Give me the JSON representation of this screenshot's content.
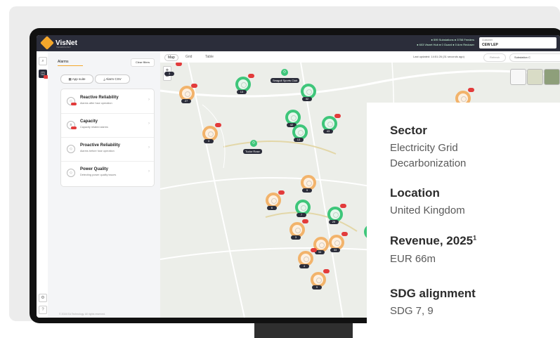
{
  "app": {
    "logo_text": "VisNet",
    "logo_sub": "TECHNOLOGY",
    "stats_line1": "● 599 Substations  ● 3758 Feeders",
    "stats_line2": "● 603 Visnet Hub  ● 0 Guard  ● 0 Arm Recloser",
    "customer_label": "Customer",
    "customer_value": "CEW LEP"
  },
  "left_panel": {
    "tab": "Alarms",
    "clear_filters": "Clear filters",
    "app_suite": "App suite",
    "alarm_csv": "Alarm CSV",
    "items": [
      {
        "title": "Reactive Reliability",
        "sub": "Alarms after fuse operation"
      },
      {
        "title": "Capacity",
        "sub": "Capacity related alarms"
      },
      {
        "title": "Proactive Reliability",
        "sub": "Alarms before fuse operation"
      },
      {
        "title": "Power Quality",
        "sub": "Detecting power quality issues"
      }
    ],
    "copyright": "© 2024 EA Technology. All rights reserved."
  },
  "map": {
    "tabs": [
      "Map",
      "Grid",
      "Table"
    ],
    "last_updated": "Last updated: 14:51:26 (31 seconds ago)",
    "refresh": "Refresh",
    "substation": "Substation C",
    "zoom_in": "+",
    "zoom_out": "−",
    "labels": {
      "sports_club": "Seagull Sports Club",
      "tudor_rose": "Tudor Rose"
    },
    "counts": [
      "3",
      "27",
      "13",
      "32",
      "3",
      "42",
      "43",
      "13",
      "9",
      "6",
      "7",
      "29",
      "3",
      "33",
      "3",
      "34",
      "4",
      "9"
    ]
  },
  "info": {
    "sector_label": "Sector",
    "sector_value_1": "Electricity Grid",
    "sector_value_2": "Decarbonization",
    "location_label": "Location",
    "location_value": "United Kingdom",
    "revenue_label": "Revenue, 2025",
    "revenue_sup": "1",
    "revenue_value": "EUR 66m",
    "sdg_label": "SDG alignment",
    "sdg_value": "SDG 7, 9"
  }
}
